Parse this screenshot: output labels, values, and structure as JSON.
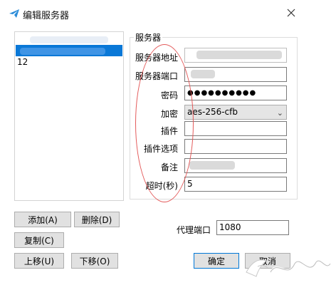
{
  "window": {
    "title": "编辑服务器"
  },
  "server_list": {
    "items": [
      "",
      "12"
    ]
  },
  "buttons": {
    "add": "添加(A)",
    "delete": "删除(D)",
    "copy": "复制(C)",
    "move_up": "上移(U)",
    "move_down": "下移(O)",
    "ok": "确定",
    "cancel": "取消"
  },
  "server_group": {
    "title": "服务器",
    "labels": {
      "address": "服务器地址",
      "port": "服务器端口",
      "password": "密码",
      "encryption": "加密",
      "plugin": "插件",
      "plugin_options": "插件选项",
      "remarks": "备注",
      "timeout": "超时(秒)"
    },
    "values": {
      "address": "",
      "port": "",
      "password": "●●●●●●●●●●",
      "encryption": "aes-256-cfb",
      "plugin": "",
      "plugin_options": "",
      "remarks": "",
      "timeout": "5"
    }
  },
  "proxy": {
    "label": "代理端口",
    "value": "1080"
  },
  "colors": {
    "selection": "#0a78d7",
    "annotation": "#e35a5a"
  }
}
